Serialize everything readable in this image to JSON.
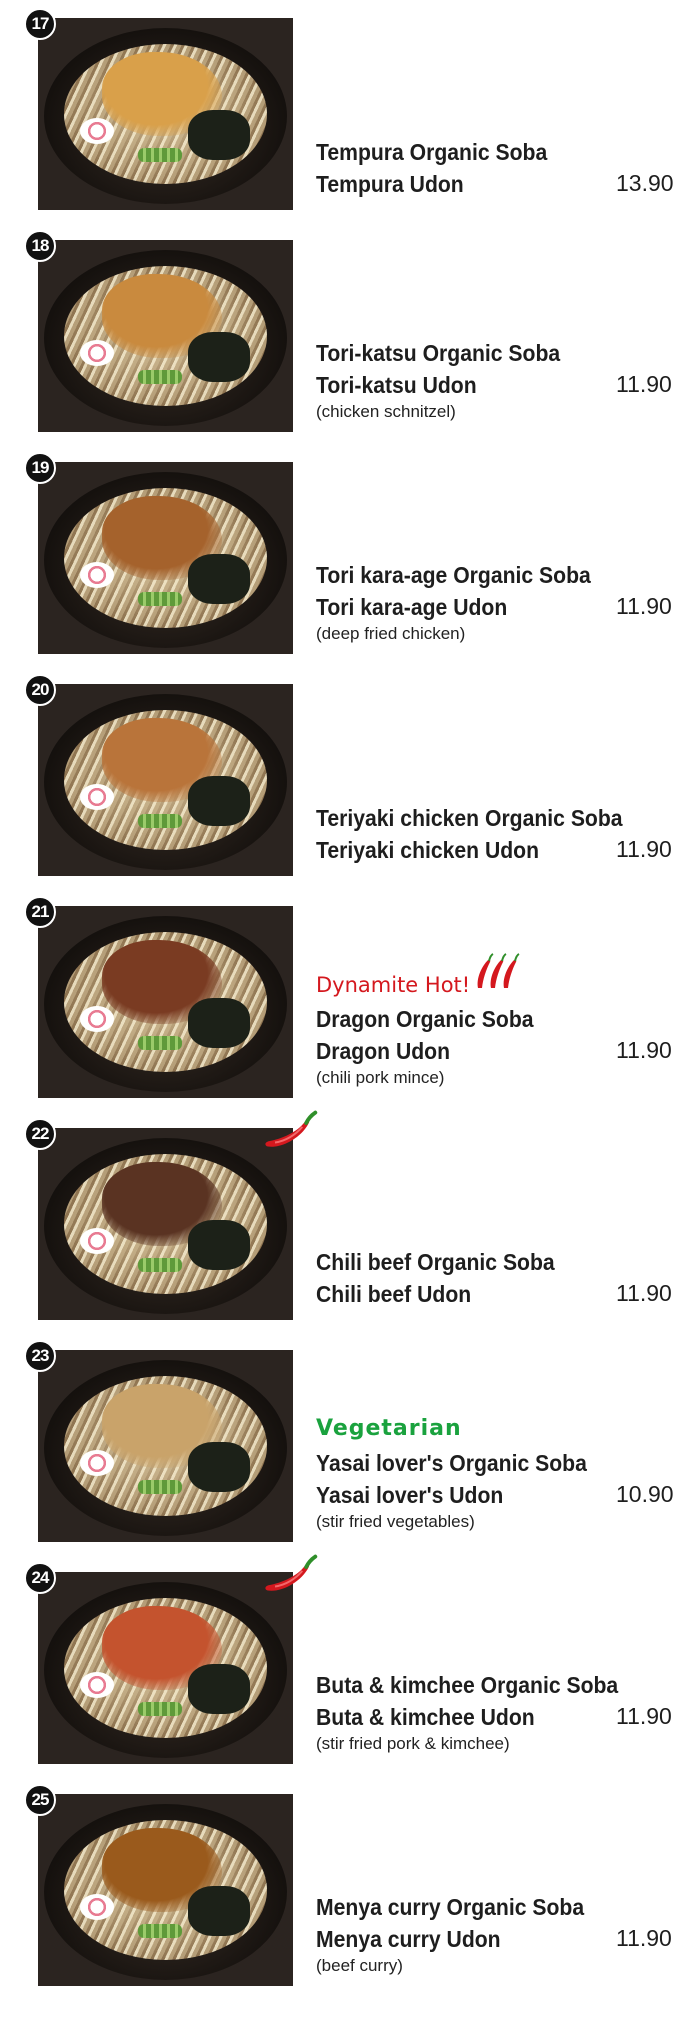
{
  "items": [
    {
      "number": "17",
      "name_soba": "Tempura Organic Soba",
      "name_udon": "Tempura Udon",
      "price": "13.90",
      "desc": "",
      "tag": "",
      "side_chili": false,
      "topping_color": "#d9a04a"
    },
    {
      "number": "18",
      "name_soba": "Tori-katsu Organic Soba",
      "name_udon": "Tori-katsu Udon",
      "price": "11.90",
      "desc": "(chicken schnitzel)",
      "tag": "",
      "side_chili": false,
      "topping_color": "#c98a3e"
    },
    {
      "number": "19",
      "name_soba": "Tori kara-age Organic Soba",
      "name_udon": "Tori kara-age Udon",
      "price": "11.90",
      "desc": "(deep fried chicken)",
      "tag": "",
      "side_chili": false,
      "topping_color": "#a5622c"
    },
    {
      "number": "20",
      "name_soba": "Teriyaki chicken Organic Soba",
      "name_udon": "Teriyaki chicken Udon",
      "price": "11.90",
      "desc": "",
      "tag": "",
      "side_chili": false,
      "topping_color": "#b9743a"
    },
    {
      "number": "21",
      "name_soba": "Dragon Organic Soba",
      "name_udon": "Dragon Udon",
      "price": "11.90",
      "desc": "(chili pork mince)",
      "tag": "Dynamite Hot!",
      "tag_type": "hot",
      "side_chili": false,
      "topping_color": "#7a3b22"
    },
    {
      "number": "22",
      "name_soba": "Chili beef Organic Soba",
      "name_udon": "Chili beef Udon",
      "price": "11.90",
      "desc": "",
      "tag": "",
      "side_chili": true,
      "topping_color": "#5a3322"
    },
    {
      "number": "23",
      "name_soba": "Yasai lover's Organic Soba",
      "name_udon": "Yasai lover's Udon",
      "price": "10.90",
      "desc": "(stir fried vegetables)",
      "tag": "Vegetarian",
      "tag_type": "veg",
      "side_chili": false,
      "topping_color": "#c9a36a"
    },
    {
      "number": "24",
      "name_soba": "Buta & kimchee Organic Soba",
      "name_udon": "Buta & kimchee Udon",
      "price": "11.90",
      "desc": "(stir fried pork & kimchee)",
      "tag": "",
      "side_chili": true,
      "topping_color": "#c4532e"
    },
    {
      "number": "25",
      "name_soba": "Menya curry Organic Soba",
      "name_udon": "Menya curry Udon",
      "price": "11.90",
      "desc": "(beef curry)",
      "tag": "",
      "side_chili": false,
      "topping_color": "#9a5a1c"
    }
  ],
  "colors": {
    "hot_red": "#d4181e",
    "veg_green": "#1aa23e",
    "badge_black": "#111111"
  },
  "icons": {
    "side_chili": "chili-pepper-icon",
    "hot_chilis": "three-chili-peppers-icon"
  }
}
